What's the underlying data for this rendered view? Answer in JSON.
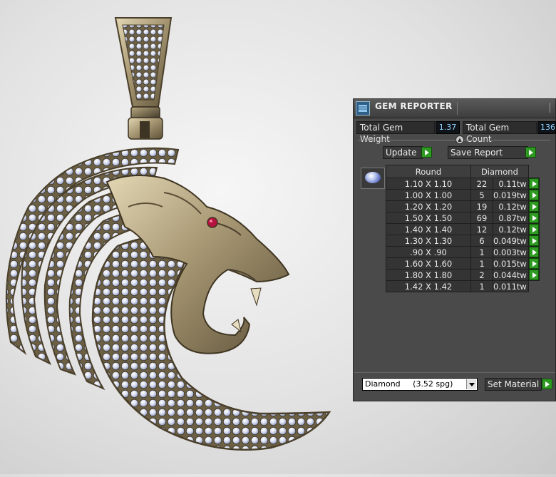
{
  "panel": {
    "title": "GEM REPORTER",
    "total_weight_label": "Total Gem Weight",
    "total_weight_value": "1.37",
    "total_count_label": "Total Gem Count",
    "total_count_value": "136",
    "update_label": "Update",
    "save_report_label": "Save Report",
    "table": {
      "headers": [
        "Round",
        "Diamond"
      ],
      "rows": [
        {
          "size": "1.10 X 1.10",
          "count": "22",
          "weight": "0.11tw"
        },
        {
          "size": "1.00 X 1.00",
          "count": "5",
          "weight": "0.019tw"
        },
        {
          "size": "1.20 X 1.20",
          "count": "19",
          "weight": "0.12tw"
        },
        {
          "size": "1.50 X 1.50",
          "count": "69",
          "weight": "0.87tw"
        },
        {
          "size": "1.40 X 1.40",
          "count": "12",
          "weight": "0.12tw"
        },
        {
          "size": "1.30 X 1.30",
          "count": "6",
          "weight": "0.049tw"
        },
        {
          "size": ".90 X .90",
          "count": "1",
          "weight": "0.003tw"
        },
        {
          "size": "1.60 X 1.60",
          "count": "1",
          "weight": "0.015tw"
        },
        {
          "size": "1.80 X 1.80",
          "count": "2",
          "weight": "0.044tw"
        },
        {
          "size": "1.42 X 1.42",
          "count": "1",
          "weight": "0.011tw"
        }
      ]
    },
    "material_value": "Diamond     (3.52 spg)",
    "set_material_label": "Set Material"
  },
  "colors": {
    "panel_bg": "#4a4a4a",
    "accent_green": "#2e9a22",
    "value_text": "#8fd3ff",
    "metal_gold": "#a99a78"
  },
  "icons": {
    "title": "gem-reporter-icon",
    "thumb": "round-diamond-icon",
    "arrow": "green-play-arrow-icon",
    "dropdown": "chevron-down-icon"
  }
}
